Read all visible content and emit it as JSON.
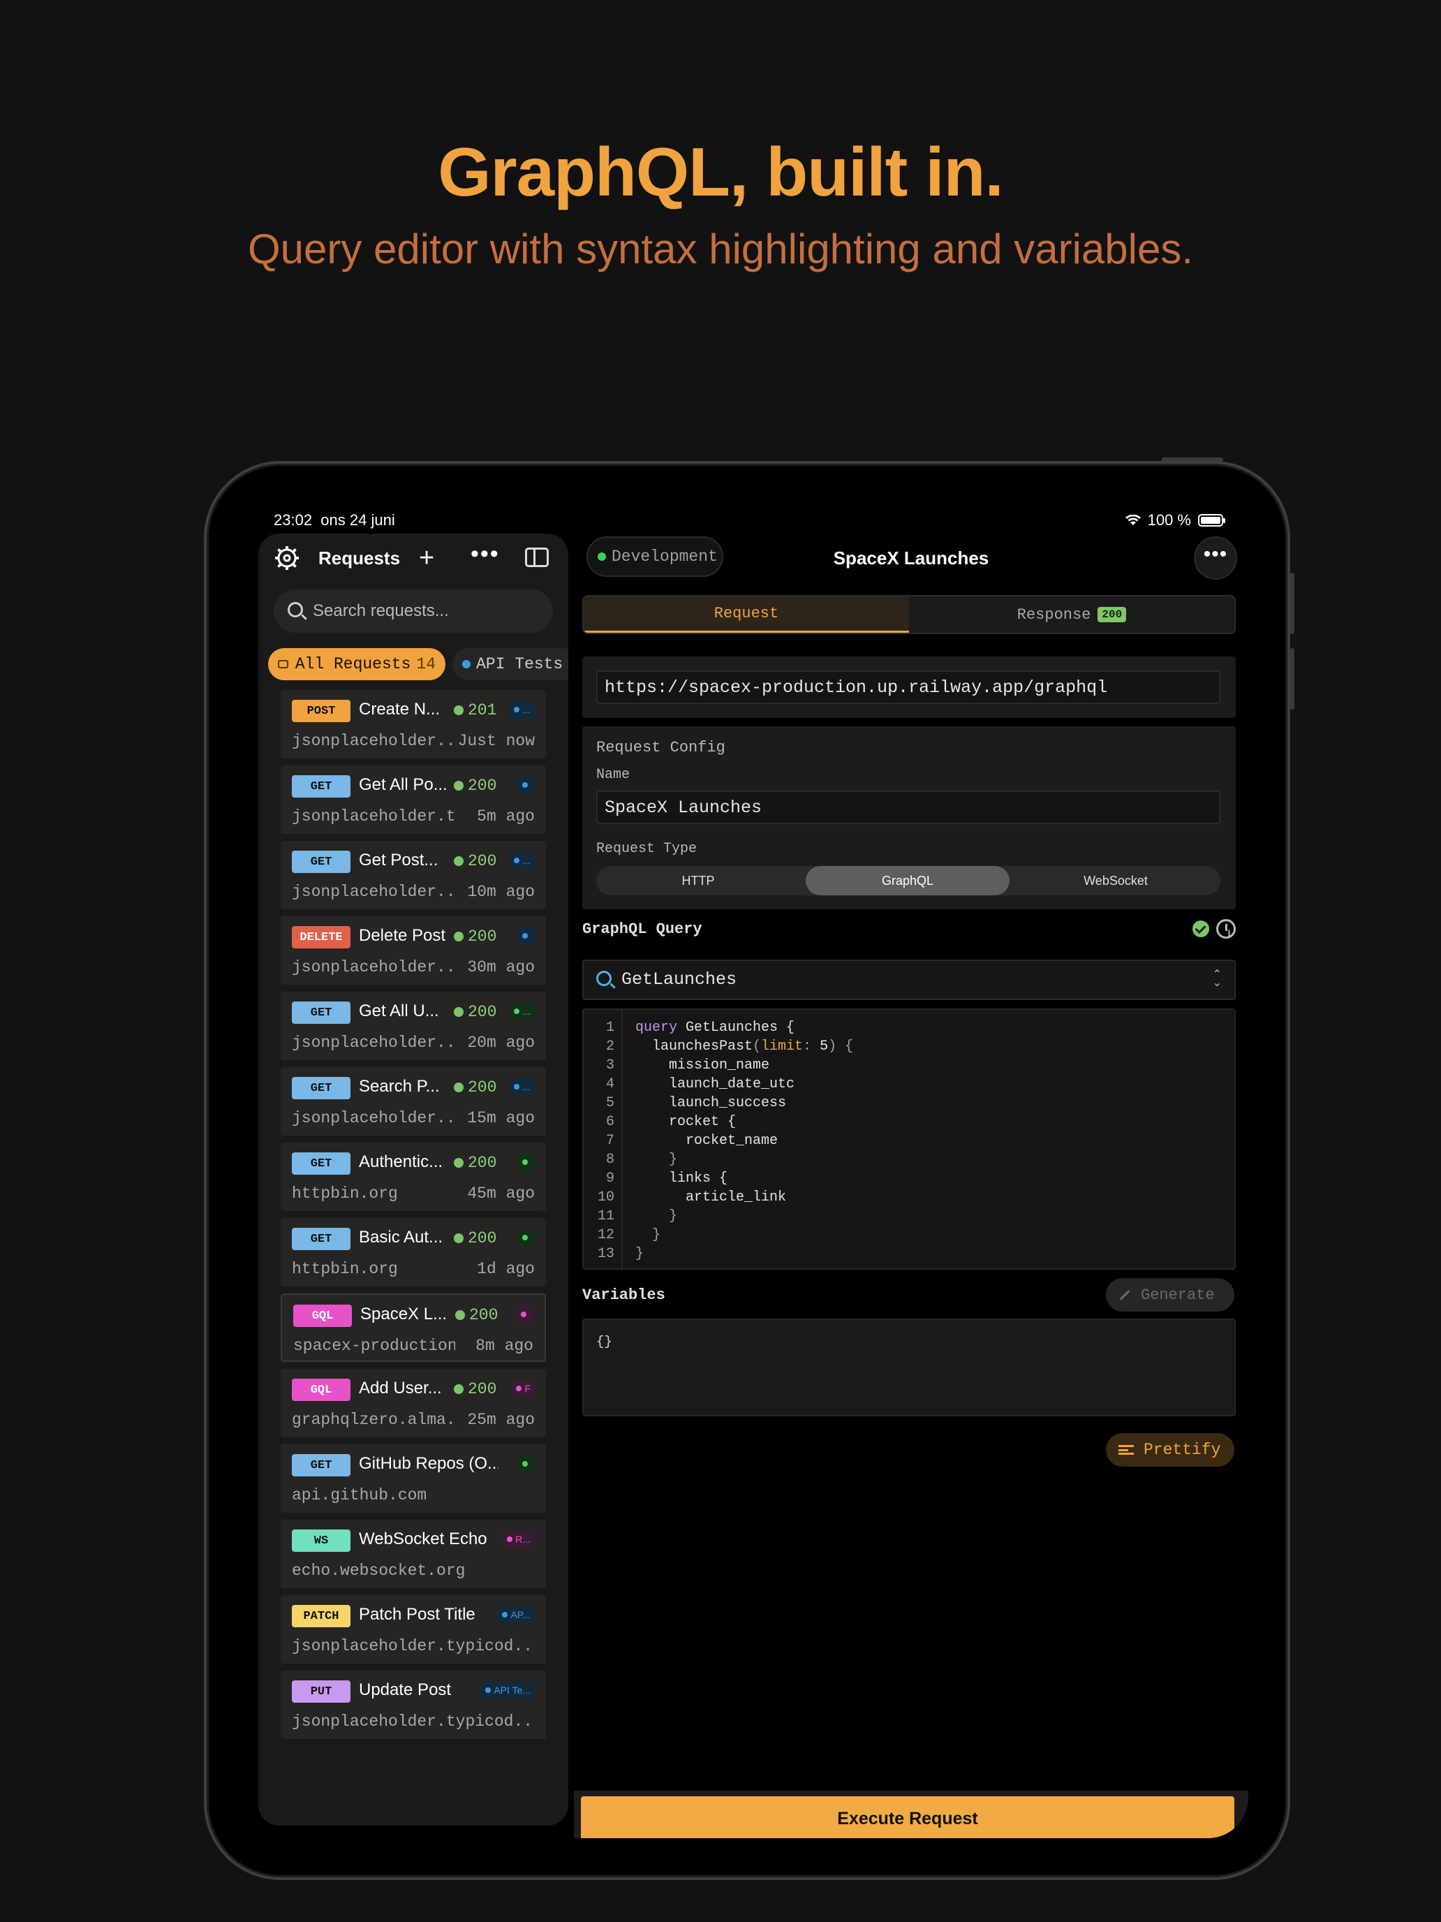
{
  "marketing": {
    "headline": "GraphQL, built in.",
    "subline": "Query editor with syntax highlighting and variables."
  },
  "status_bar": {
    "time": "23:02",
    "date": "ons 24 juni",
    "battery": "100 %"
  },
  "sidebar": {
    "title": "Requests",
    "search_placeholder": "Search requests...",
    "chip_all": "All Requests",
    "chip_all_count": "14",
    "chip_other": "API Tests",
    "items": [
      {
        "method": "POST",
        "name": "Create N...",
        "status": "201",
        "host": "jsonplaceholder...",
        "time": "Just now",
        "tag": "..."
      },
      {
        "method": "GET",
        "name": "Get All Po...",
        "status": "200",
        "host": "jsonplaceholder.t...",
        "time": "5m ago",
        "tag": ""
      },
      {
        "method": "GET",
        "name": "Get Post...",
        "status": "200",
        "host": "jsonplaceholder...",
        "time": "10m ago",
        "tag": "..."
      },
      {
        "method": "DELETE",
        "name": "Delete Post",
        "status": "200",
        "host": "jsonplaceholder...",
        "time": "30m ago",
        "tag": ""
      },
      {
        "method": "GET",
        "name": "Get All U...",
        "status": "200",
        "host": "jsonplaceholder...",
        "time": "20m ago",
        "tag": "..."
      },
      {
        "method": "GET",
        "name": "Search P...",
        "status": "200",
        "host": "jsonplaceholder...",
        "time": "15m ago",
        "tag": "..."
      },
      {
        "method": "GET",
        "name": "Authentic...",
        "status": "200",
        "host": "httpbin.org",
        "time": "45m ago",
        "tag": ""
      },
      {
        "method": "GET",
        "name": "Basic Aut...",
        "status": "200",
        "host": "httpbin.org",
        "time": "1d ago",
        "tag": ""
      },
      {
        "method": "GQL",
        "name": "SpaceX L...",
        "status": "200",
        "host": "spacex-production...",
        "time": "8m ago",
        "tag": ""
      },
      {
        "method": "GQL",
        "name": "Add User...",
        "status": "200",
        "host": "graphqlzero.alma...",
        "time": "25m ago",
        "tag": "F"
      },
      {
        "method": "GET",
        "name": "GitHub Repos (O...",
        "status": "",
        "host": "api.github.com",
        "time": "",
        "tag": ""
      },
      {
        "method": "WS",
        "name": "WebSocket Echo",
        "status": "",
        "host": "echo.websocket.org",
        "time": "",
        "tag": "R..."
      },
      {
        "method": "PATCH",
        "name": "Patch Post Title",
        "status": "",
        "host": "jsonplaceholder.typicod...",
        "time": "",
        "tag": "AP..."
      },
      {
        "method": "PUT",
        "name": "Update Post",
        "status": "",
        "host": "jsonplaceholder.typicod...",
        "time": "",
        "tag": "API Te..."
      }
    ]
  },
  "main": {
    "environment": "Development",
    "title": "SpaceX Launches",
    "tabs": {
      "request": "Request",
      "response": "Response",
      "response_code": "200"
    },
    "url": "https://spacex-production.up.railway.app/graphql",
    "config": {
      "section": "Request Config",
      "name_label": "Name",
      "name_value": "SpaceX Launches",
      "type_label": "Request Type",
      "types": [
        "HTTP",
        "GraphQL",
        "WebSocket"
      ],
      "selected_type": "GraphQL"
    },
    "query_section": "GraphQL Query",
    "operation": "GetLaunches",
    "line_numbers": [
      "1",
      "2",
      "3",
      "4",
      "5",
      "6",
      "7",
      "8",
      "9",
      "10",
      "11",
      "12",
      "13"
    ],
    "code": {
      "l1_kw": "query",
      "l1_rest": " GetLaunches {",
      "l2_field": "  launchesPast",
      "l2_paren": "(",
      "l2_arg": "limit",
      "l2_colon": ": ",
      "l2_num": "5",
      "l2_end": ") {",
      "l3": "    mission_name",
      "l4": "    launch_date_utc",
      "l5": "    launch_success",
      "l6": "    rocket {",
      "l7": "      rocket_name",
      "l8": "    }",
      "l9": "    links {",
      "l10": "      article_link",
      "l11": "    }",
      "l12": "  }",
      "l13": "}"
    },
    "variables_section": "Variables",
    "generate": "Generate",
    "variables_value": "{}",
    "prettify": "Prettify",
    "execute": "Execute Request"
  },
  "colors": {
    "accent": "#f0a33e",
    "post": "#f0a33e",
    "get": "#7ab8e8",
    "delete": "#e0604a",
    "gql": "#e653c9",
    "ws": "#6fe0c0",
    "patch": "#f7d46a",
    "put": "#c79af0"
  }
}
